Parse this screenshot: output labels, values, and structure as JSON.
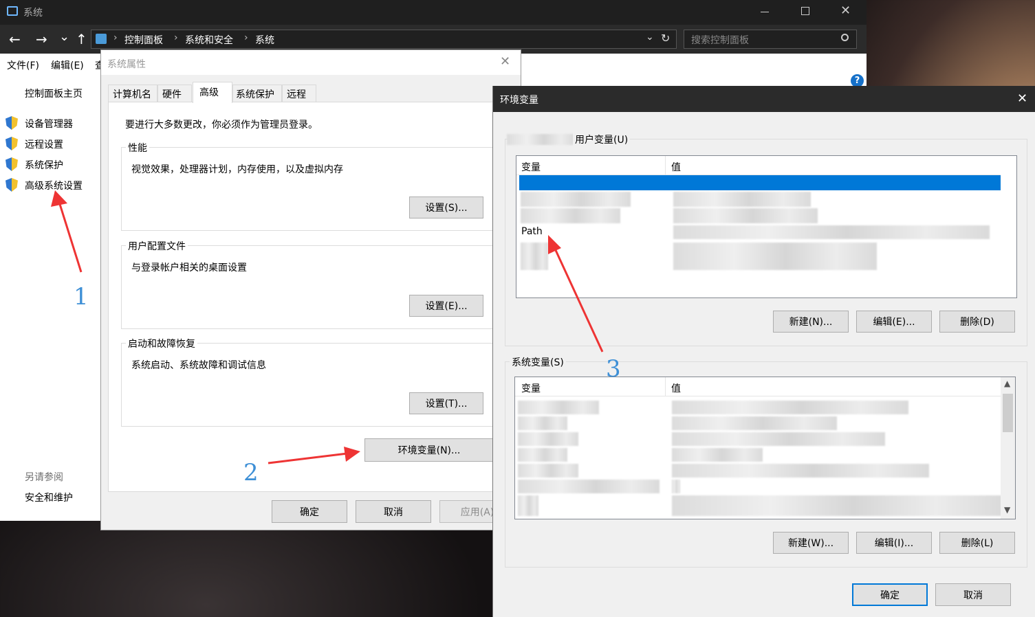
{
  "system_window": {
    "title": "系统",
    "back": "←",
    "forward": "→",
    "down": "⌄",
    "up": "↑",
    "breadcrumb": [
      "控制面板",
      "系统和安全",
      "系统"
    ],
    "search_placeholder": "搜索控制面板",
    "menu": [
      "文件(F)",
      "编辑(E)",
      "查"
    ],
    "sidebar": {
      "home": "控制面板主页",
      "items": [
        "设备管理器",
        "远程设置",
        "系统保护",
        "高级系统设置"
      ],
      "see_also": "另请参阅",
      "see_also_items": [
        "安全和维护"
      ]
    }
  },
  "sys_props": {
    "title": "系统属性",
    "tabs": [
      "计算机名",
      "硬件",
      "高级",
      "系统保护",
      "远程"
    ],
    "active_tab": "高级",
    "admin_note": "要进行大多数更改，你必须作为管理员登录。",
    "groups": [
      {
        "title": "性能",
        "desc": "视觉效果，处理器计划，内存使用，以及虚拟内存",
        "button": "设置(S)..."
      },
      {
        "title": "用户配置文件",
        "desc": "与登录帐户相关的桌面设置",
        "button": "设置(E)..."
      },
      {
        "title": "启动和故障恢复",
        "desc": "系统启动、系统故障和调试信息",
        "button": "设置(T)..."
      }
    ],
    "env_button": "环境变量(N)...",
    "ok": "确定",
    "cancel": "取消",
    "apply": "应用(A)"
  },
  "env_dialog": {
    "title": "环境变量",
    "user_vars_title": "用户变量(U)",
    "col_var": "变量",
    "col_val": "值",
    "user_rows": [
      {
        "var": "",
        "value": ""
      },
      {
        "var": "",
        "value": ""
      },
      {
        "var": "",
        "value": ""
      },
      {
        "var": "Path",
        "value": ""
      },
      {
        "var": "",
        "value": ""
      }
    ],
    "user_buttons": [
      "新建(N)...",
      "编辑(E)...",
      "删除(D)"
    ],
    "sys_vars_title": "系统变量(S)",
    "sys_buttons": [
      "新建(W)...",
      "编辑(I)...",
      "删除(L)"
    ],
    "ok": "确定",
    "cancel": "取消"
  },
  "annotations": {
    "n1": "1",
    "n2": "2",
    "n3": "3"
  },
  "colors": {
    "accent": "#0078d7",
    "selection": "#0078d7",
    "arrow": "#ee3434",
    "annotation": "#3d8fd6"
  }
}
